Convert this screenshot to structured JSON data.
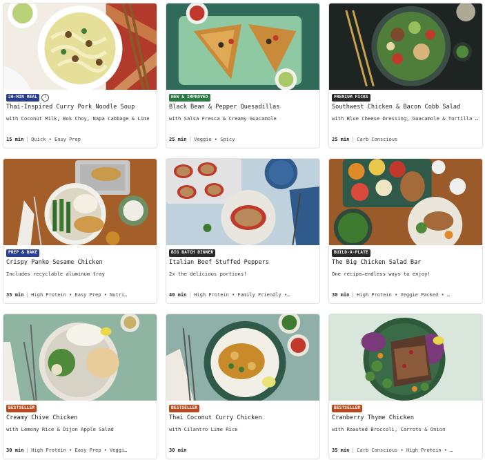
{
  "recipes": [
    {
      "badge": "20-MIN MEAL",
      "badge_color": "#2a3f8f",
      "has_info": true,
      "title": "Thai-Inspired Curry Pork Noodle Soup",
      "subtitle": "with Coconut Milk, Bok Choy, Napa Cabbage & Lime",
      "time": "15 min",
      "tags": "Quick • Easy Prep"
    },
    {
      "badge": "NEW & IMPROVED",
      "badge_color": "#2c7a43",
      "has_info": false,
      "title": "Black Bean & Pepper Quesadillas",
      "subtitle": "with Salsa Fresca & Creamy Guacamole",
      "time": "25 min",
      "tags": "Veggie • Spicy"
    },
    {
      "badge": "PREMIUM PICKS",
      "badge_color": "#2a2a2a",
      "has_info": false,
      "title": "Southwest Chicken & Bacon Cobb Salad",
      "subtitle": "with Blue Cheese Dressing, Guacamole & Tortilla Ch…",
      "time": "25 min",
      "tags": "Carb Conscious"
    },
    {
      "badge": "PREP & BAKE",
      "badge_color": "#2a3f8f",
      "has_info": false,
      "title": "Crispy Panko Sesame Chicken",
      "subtitle": "Includes recyclable aluminum tray",
      "time": "35 min",
      "tags": "High Protein • Easy Prep • Nutri…"
    },
    {
      "badge": "BIG BATCH DINNER",
      "badge_color": "#2a2a2a",
      "has_info": false,
      "title": "Italian Beef Stuffed Peppers",
      "subtitle": "2x the delicious portions!",
      "time": "40 min",
      "tags": "High Protein • Family Friendly •…"
    },
    {
      "badge": "BUILD-A-PLATE",
      "badge_color": "#2a2a2a",
      "has_info": false,
      "title": "The Big Chicken Salad Bar",
      "subtitle": "One recipe—endless ways to enjoy!",
      "time": "30 min",
      "tags": "High Protein • Veggie Packed • …"
    },
    {
      "badge": "BESTSELLER",
      "badge_color": "#b84a1e",
      "has_info": false,
      "title": "Creamy Chive Chicken",
      "subtitle": "with Lemony Rice & Dijon Apple Salad",
      "time": "30 min",
      "tags": "High Protein • Easy Prep • Veggi…"
    },
    {
      "badge": "BESTSELLER",
      "badge_color": "#b84a1e",
      "has_info": false,
      "title": "Thai Coconut Curry Chicken",
      "subtitle": "with Cilantro Lime Rice",
      "time": "30 min",
      "tags": ""
    },
    {
      "badge": "BESTSELLER",
      "badge_color": "#b84a1e",
      "has_info": false,
      "title": "Cranberry Thyme Chicken",
      "subtitle": "with Roasted Broccoli, Carrots & Onion",
      "time": "35 min",
      "tags": "Carb Conscious • High Protein • …"
    }
  ],
  "info_icon": "info-icon"
}
